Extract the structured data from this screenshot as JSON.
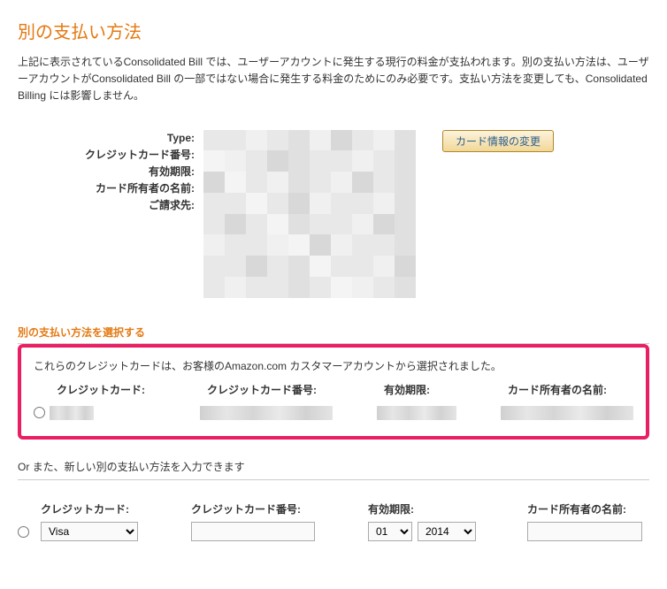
{
  "title": "別の支払い方法",
  "intro": "上記に表示されているConsolidated Bill では、ユーザーアカウントに発生する現行の料金が支払われます。別の支払い方法は、ユーザーアカウントがConsolidated Bill の一部ではない場合に発生する料金のためにのみ必要です。支払い方法を変更しても、Consolidated Billing には影響しません。",
  "fields": {
    "type": "Type:",
    "card_number": "クレジットカード番号:",
    "expiry": "有効期限:",
    "holder": "カード所有者の名前:",
    "billing": "ご請求先:"
  },
  "change_button": "カード情報の変更",
  "select_section": "別の支払い方法を選択する",
  "existing_note": "これらのクレジットカードは、お客様のAmazon.com カスタマーアカウントから選択されました。",
  "cols": {
    "card": "クレジットカード:",
    "card_number": "クレジットカード番号:",
    "expiry": "有効期限:",
    "holder": "カード所有者の名前:"
  },
  "or_line": "Or また、新しい別の支払い方法を入力できます",
  "new": {
    "card_type": "Visa",
    "month": "01",
    "year": "2014"
  }
}
